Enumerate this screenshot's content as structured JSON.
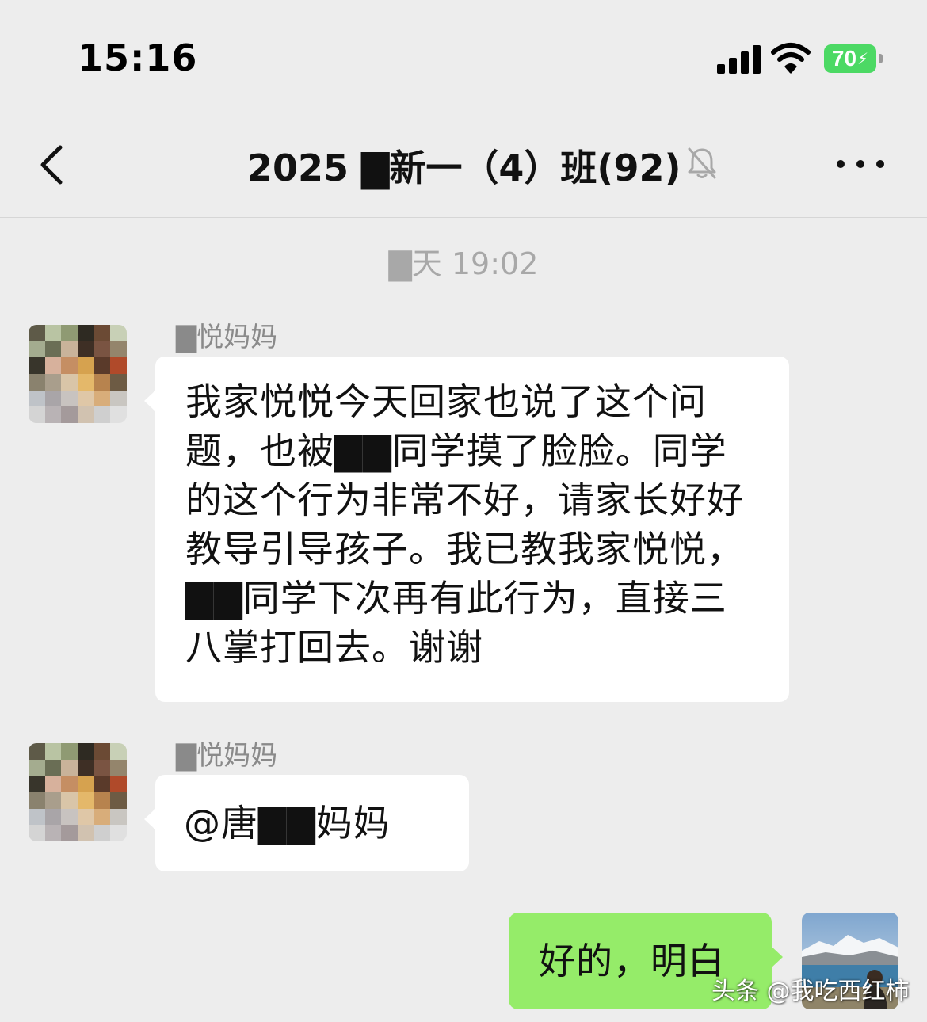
{
  "status_bar": {
    "time": "15:16",
    "battery_level": "70",
    "battery_color": "#4cd964"
  },
  "nav_bar": {
    "back_icon": "chevron-left-icon",
    "title": "2025 ▇新一（4）班(92)",
    "mute_icon": "bell-slash-icon",
    "more_icon": "ellipsis-icon"
  },
  "messages": {
    "timestamp": "▇天 19:02",
    "items": [
      {
        "sender": "▇悦妈妈",
        "side": "left",
        "text": "我家悦悦今天回家也说了这个问题，也被▇▇同学摸了脸脸。同学的这个行为非常不好，请家长好好教导引导孩子。我已教我家悦悦，▇▇同学下次再有此行为，直接三八掌打回去。谢谢"
      },
      {
        "sender": "▇悦妈妈",
        "side": "left",
        "text": "@唐▇▇妈妈"
      },
      {
        "sender": "",
        "side": "right",
        "text": "好的，明白"
      }
    ]
  },
  "colors": {
    "background": "#ededed",
    "incoming_bubble": "#ffffff",
    "outgoing_bubble": "#95ec69",
    "timestamp_text": "#a8a8a8",
    "sender_text": "#8a8a8a"
  },
  "watermark": "头条 @我吃西红柿"
}
